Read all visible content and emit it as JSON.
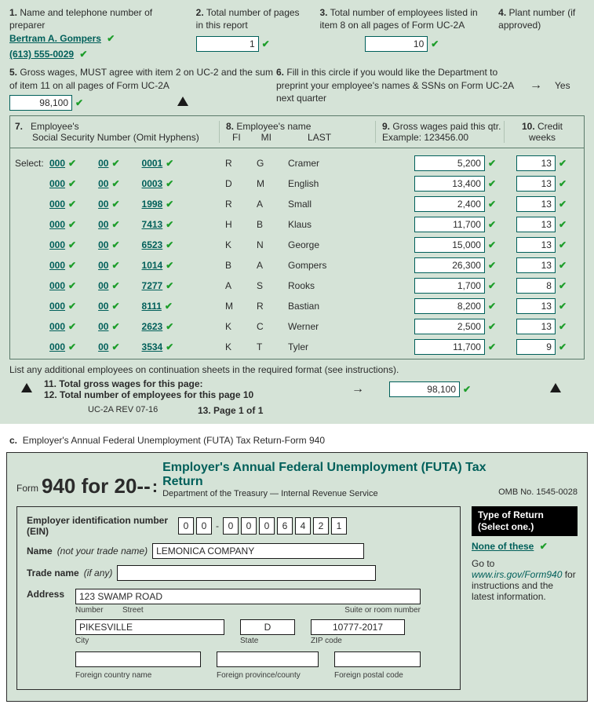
{
  "uc2a": {
    "q1": {
      "num": "1.",
      "label": "Name and telephone number of preparer",
      "name": "Bertram A. Gompers",
      "phone": "(613) 555-0029"
    },
    "q2": {
      "num": "2.",
      "label": "Total number of pages in this report",
      "value": "1"
    },
    "q3": {
      "num": "3.",
      "label": "Total number of employees listed in item 8 on all pages of Form UC-2A",
      "value": "10"
    },
    "q4": {
      "num": "4.",
      "label": "Plant number (if approved)"
    },
    "q5": {
      "num": "5.",
      "label": "Gross wages, MUST agree with item 2 on UC-2 and the sum of item 11 on all pages of Form UC-2A",
      "value": "98,100"
    },
    "q6": {
      "num": "6.",
      "label": "Fill in this circle if you would like the Department to preprint your employee's names & SSNs on Form UC-2A next quarter",
      "yes": "Yes"
    },
    "head": {
      "num7": "7.",
      "ssn_line1": "Employee's",
      "ssn_line2": "Social Security Number (Omit Hyphens)",
      "num8": "8.",
      "name_label": "Employee's name",
      "fi": "FI",
      "mi": "MI",
      "last": "LAST",
      "num9": "9.",
      "wages_label": "Gross wages paid this qtr.",
      "wages_ex": "Example: 123456.00",
      "num10": "10.",
      "credit_label": "Credit weeks"
    },
    "select_label": "Select:",
    "rows": [
      {
        "s1": "000",
        "s2": "00",
        "s3": "0001",
        "fi": "R",
        "mi": "G",
        "last": "Cramer",
        "wages": "5,200",
        "credit": "13"
      },
      {
        "s1": "000",
        "s2": "00",
        "s3": "0003",
        "fi": "D",
        "mi": "M",
        "last": "English",
        "wages": "13,400",
        "credit": "13"
      },
      {
        "s1": "000",
        "s2": "00",
        "s3": "1998",
        "fi": "R",
        "mi": "A",
        "last": "Small",
        "wages": "2,400",
        "credit": "13"
      },
      {
        "s1": "000",
        "s2": "00",
        "s3": "7413",
        "fi": "H",
        "mi": "B",
        "last": "Klaus",
        "wages": "11,700",
        "credit": "13"
      },
      {
        "s1": "000",
        "s2": "00",
        "s3": "6523",
        "fi": "K",
        "mi": "N",
        "last": "George",
        "wages": "15,000",
        "credit": "13"
      },
      {
        "s1": "000",
        "s2": "00",
        "s3": "1014",
        "fi": "B",
        "mi": "A",
        "last": "Gompers",
        "wages": "26,300",
        "credit": "13"
      },
      {
        "s1": "000",
        "s2": "00",
        "s3": "7277",
        "fi": "A",
        "mi": "S",
        "last": "Rooks",
        "wages": "1,700",
        "credit": "8"
      },
      {
        "s1": "000",
        "s2": "00",
        "s3": "8111",
        "fi": "M",
        "mi": "R",
        "last": "Bastian",
        "wages": "8,200",
        "credit": "13"
      },
      {
        "s1": "000",
        "s2": "00",
        "s3": "2623",
        "fi": "K",
        "mi": "C",
        "last": "Werner",
        "wages": "2,500",
        "credit": "13"
      },
      {
        "s1": "000",
        "s2": "00",
        "s3": "3534",
        "fi": "K",
        "mi": "T",
        "last": "Tyler",
        "wages": "11,700",
        "credit": "9"
      }
    ],
    "list_note": "List any additional employees on continuation sheets in the required format (see instructions).",
    "line11": "11. Total gross wages for this page:",
    "line11_value": "98,100",
    "line12": "12. Total number of employees for this page 10",
    "rev": "UC-2A REV 07-16",
    "line13": "13. Page 1 of 1"
  },
  "secC_intro": "c.  Employer's Annual Federal Unemployment (FUTA) Tax Return-Form 940",
  "form940": {
    "form_word": "Form",
    "number": "940 for 20--",
    "title": "Employer's Annual Federal Unemployment (FUTA) Tax Return",
    "dept": "Department of the Treasury — Internal Revenue Service",
    "omb": "OMB No. 1545-0028",
    "ein_label": "Employer identification number (EIN)",
    "ein": [
      "0",
      "0",
      "0",
      "0",
      "0",
      "6",
      "4",
      "2",
      "1"
    ],
    "name_label": "Name",
    "name_paren": "(not your trade name)",
    "name": "LEMONICA COMPANY",
    "trade_label": "Trade name",
    "trade_paren": "(if any)",
    "trade": "",
    "address_label": "Address",
    "address": "123 SWAMP ROAD",
    "addr_sub_number": "Number",
    "addr_sub_street": "Street",
    "addr_sub_suite": "Suite or room number",
    "city": "PIKESVILLE",
    "state": "D",
    "zip": "10777-2017",
    "addr_sub_city": "City",
    "addr_sub_state": "State",
    "addr_sub_zip": "ZIP code",
    "foreign_country": "",
    "foreign_province": "",
    "foreign_postal": "",
    "addr_sub_fcountry": "Foreign country name",
    "addr_sub_fprov": "Foreign province/county",
    "addr_sub_fpost": "Foreign postal code",
    "type_return_l1": "Type of Return",
    "type_return_l2": "(Select one.)",
    "none_of_these": "None of these",
    "goto_pre": "Go to ",
    "goto_link": "www.irs.gov/Form940",
    "goto_post": " for instructions and the latest information."
  }
}
